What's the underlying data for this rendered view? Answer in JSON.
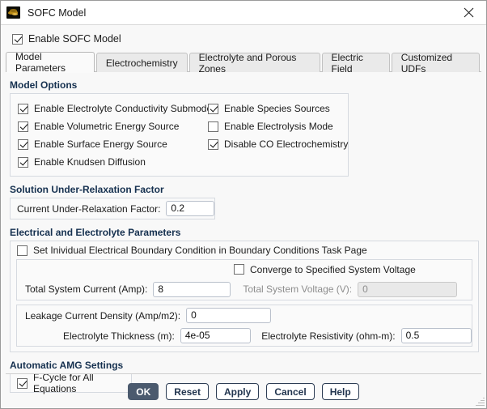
{
  "window": {
    "title": "SOFC Model",
    "icon": "fluent-app-icon",
    "close_icon": "close-icon"
  },
  "enable_model": {
    "label": "Enable SOFC Model",
    "checked": true
  },
  "tabs": [
    {
      "label": "Model Parameters",
      "active": true
    },
    {
      "label": "Electrochemistry",
      "active": false
    },
    {
      "label": "Electrolyte and Porous Zones",
      "active": false
    },
    {
      "label": "Electric Field",
      "active": false
    },
    {
      "label": "Customized UDFs",
      "active": false
    }
  ],
  "model_options": {
    "title": "Model Options",
    "left": [
      {
        "label": "Enable Electrolyte Conductivity Submodel",
        "checked": true
      },
      {
        "label": "Enable Volumetric Energy Source",
        "checked": true
      },
      {
        "label": "Enable Surface Energy Source",
        "checked": true
      },
      {
        "label": "Enable Knudsen Diffusion",
        "checked": true
      }
    ],
    "right": [
      {
        "label": "Enable Species Sources",
        "checked": true
      },
      {
        "label": "Enable Electrolysis Mode",
        "checked": false
      },
      {
        "label": "Disable CO Electrochemistry",
        "checked": true
      }
    ]
  },
  "under_relaxation": {
    "title": "Solution Under-Relaxation Factor",
    "field_label": "Current Under-Relaxation Factor:",
    "value": "0.2"
  },
  "electrical": {
    "title": "Electrical and Electrolyte Parameters",
    "individual_bc": {
      "label": "Set Inividual Electrical Boundary Condition in Boundary Conditions Task Page",
      "checked": false
    },
    "converge_voltage": {
      "label": "Converge to Specified System Voltage",
      "checked": false
    },
    "total_current": {
      "label": "Total System Current (Amp):",
      "value": "8",
      "disabled": false
    },
    "total_voltage": {
      "label": "Total System Voltage (V):",
      "value": "0",
      "disabled": true
    },
    "leakage_current": {
      "label": "Leakage Current Density (Amp/m2):",
      "value": "0"
    },
    "electrolyte_thickness": {
      "label": "Electrolyte Thickness (m):",
      "value": "4e-05"
    },
    "electrolyte_resistivity": {
      "label": "Electrolyte Resistivity (ohm-m):",
      "value": "0.5"
    }
  },
  "amg": {
    "title": "Automatic AMG Settings",
    "fcycle": {
      "label": "F-Cycle for All Equations",
      "checked": true
    }
  },
  "buttons": [
    {
      "label": "OK",
      "primary": true
    },
    {
      "label": "Reset",
      "primary": false
    },
    {
      "label": "Apply",
      "primary": false
    },
    {
      "label": "Cancel",
      "primary": false
    },
    {
      "label": "Help",
      "primary": false
    }
  ],
  "colors": {
    "dialog_bg": "#f8f8f8",
    "section_title": "#15304f",
    "primary_button_bg": "#4b5a6e",
    "button_text": "#21344e",
    "panel_border": "#d6dae0",
    "input_border": "#b9c0cb",
    "disabled_text": "#8d8d8d"
  }
}
